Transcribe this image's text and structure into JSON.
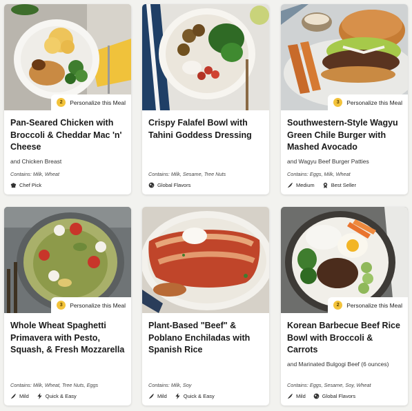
{
  "personalize_label": "Personalize this Meal",
  "meals": [
    {
      "title": "Pan-Seared Chicken with Broccoli & Cheddar Mac 'n' Cheese",
      "subtitle": "and Chicken Breast",
      "personalize_count": "2",
      "contains": "Contains: Milk, Wheat",
      "tags": [
        {
          "icon": "chef-hat-icon",
          "label": "Chef Pick"
        }
      ]
    },
    {
      "title": "Crispy Falafel Bowl with Tahini Goddess Dressing",
      "subtitle": "",
      "personalize_count": "",
      "contains": "Contains: Milk, Sesame, Tree Nuts",
      "tags": [
        {
          "icon": "globe-icon",
          "label": "Global Flavors"
        }
      ]
    },
    {
      "title": "Southwestern-Style Wagyu Green Chile Burger with Mashed Avocado",
      "subtitle": "and Wagyu Beef Burger Patties",
      "personalize_count": "3",
      "contains": "Contains: Eggs, Milk, Wheat",
      "tags": [
        {
          "icon": "pepper-icon",
          "label": "Medium"
        },
        {
          "icon": "ribbon-icon",
          "label": "Best Seller"
        }
      ]
    },
    {
      "title": "Whole Wheat Spaghetti Primavera with Pesto, Squash, & Fresh Mozzarella",
      "subtitle": "",
      "personalize_count": "3",
      "contains": "Contains: Milk, Wheat, Tree Nuts, Eggs",
      "tags": [
        {
          "icon": "pepper-icon",
          "label": "Mild"
        },
        {
          "icon": "lightning-icon",
          "label": "Quick & Easy"
        }
      ]
    },
    {
      "title": "Plant-Based \"Beef\" & Poblano Enchiladas with Spanish Rice",
      "subtitle": "",
      "personalize_count": "",
      "contains": "Contains: Milk, Soy",
      "tags": [
        {
          "icon": "pepper-icon",
          "label": "Mild"
        },
        {
          "icon": "lightning-icon",
          "label": "Quick & Easy"
        }
      ]
    },
    {
      "title": "Korean Barbecue Beef Rice Bowl with Broccoli & Carrots",
      "subtitle": "and Marinated Bulgogi Beef (6 ounces)",
      "personalize_count": "2",
      "contains": "Contains: Eggs, Sesame, Soy, Wheat",
      "tags": [
        {
          "icon": "pepper-icon",
          "label": "Mild"
        },
        {
          "icon": "globe-icon",
          "label": "Global Flavors"
        }
      ]
    }
  ]
}
